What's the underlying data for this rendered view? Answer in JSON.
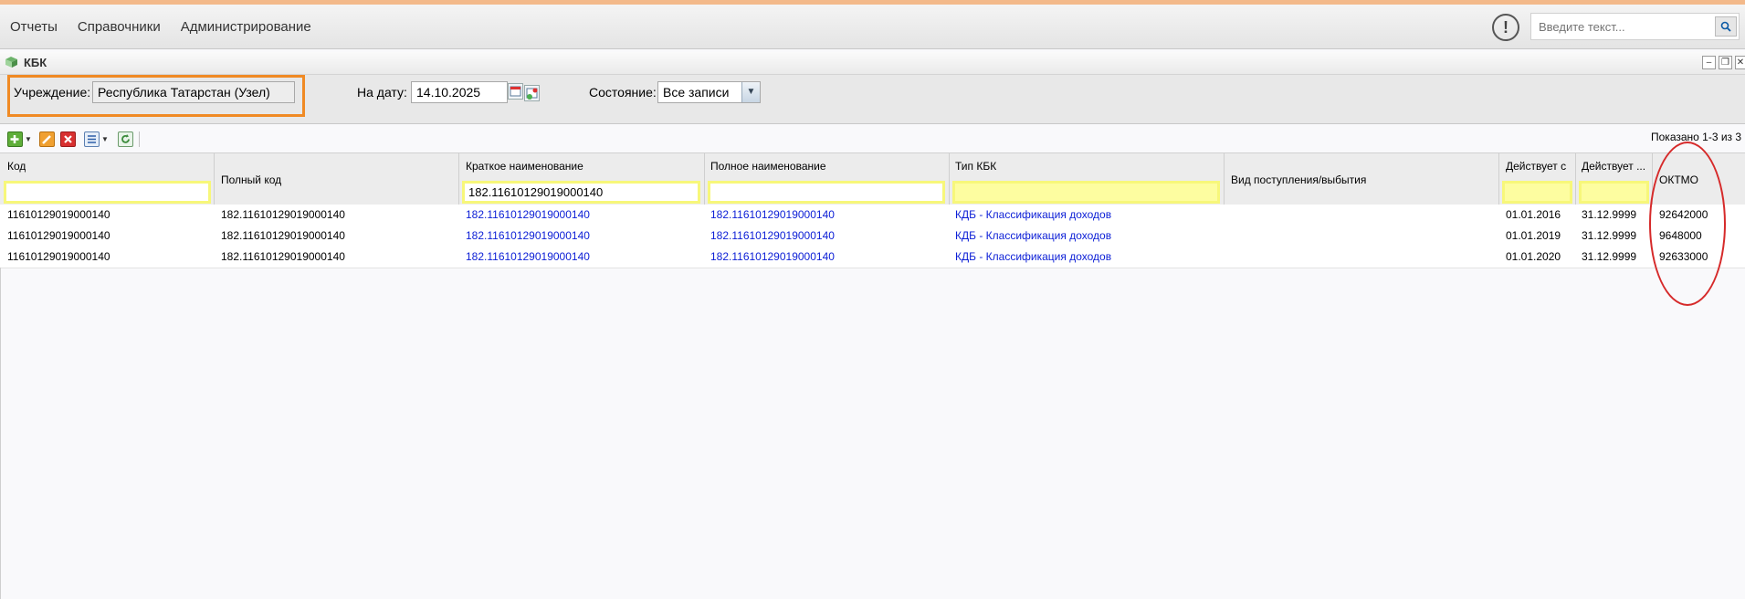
{
  "menu": {
    "items": [
      "Отчеты",
      "Справочники",
      "Администрирование"
    ]
  },
  "search": {
    "placeholder": "Введите текст..."
  },
  "window": {
    "title": "КБК"
  },
  "filters": {
    "institution_label": "Учреждение:",
    "institution_value": "Республика Татарстан (Узел)",
    "date_label": "На дату:",
    "date_value": "14.10.2025",
    "state_label": "Состояние:",
    "state_value": "Все записи"
  },
  "toolbar": {
    "shown_text": "Показано 1-3 из 3"
  },
  "grid": {
    "columns": [
      "Код",
      "Полный код",
      "Краткое наименование",
      "Полное наименование",
      "Тип КБК",
      "Вид поступления/выбытия",
      "Действует с",
      "Действует ...",
      "ОКТМО"
    ],
    "filter_values": {
      "short_name": "182.11610129019000140"
    },
    "rows": [
      [
        "11610129019000140",
        "182.11610129019000140",
        "182.11610129019000140",
        "182.11610129019000140",
        "КДБ - Классификация доходов",
        "",
        "01.01.2016",
        "31.12.9999",
        "92642000"
      ],
      [
        "11610129019000140",
        "182.11610129019000140",
        "182.11610129019000140",
        "182.11610129019000140",
        "КДБ - Классификация доходов",
        "",
        "01.01.2019",
        "31.12.9999",
        "9648000"
      ],
      [
        "11610129019000140",
        "182.11610129019000140",
        "182.11610129019000140",
        "182.11610129019000140",
        "КДБ - Классификация доходов",
        "",
        "01.01.2020",
        "31.12.9999",
        "92633000"
      ]
    ]
  },
  "colors": {
    "accent_orange": "#f08a24",
    "highlight_yellow": "#f7f77a",
    "link_blue": "#0b1ed6",
    "annotation_red": "#d62a2a"
  }
}
